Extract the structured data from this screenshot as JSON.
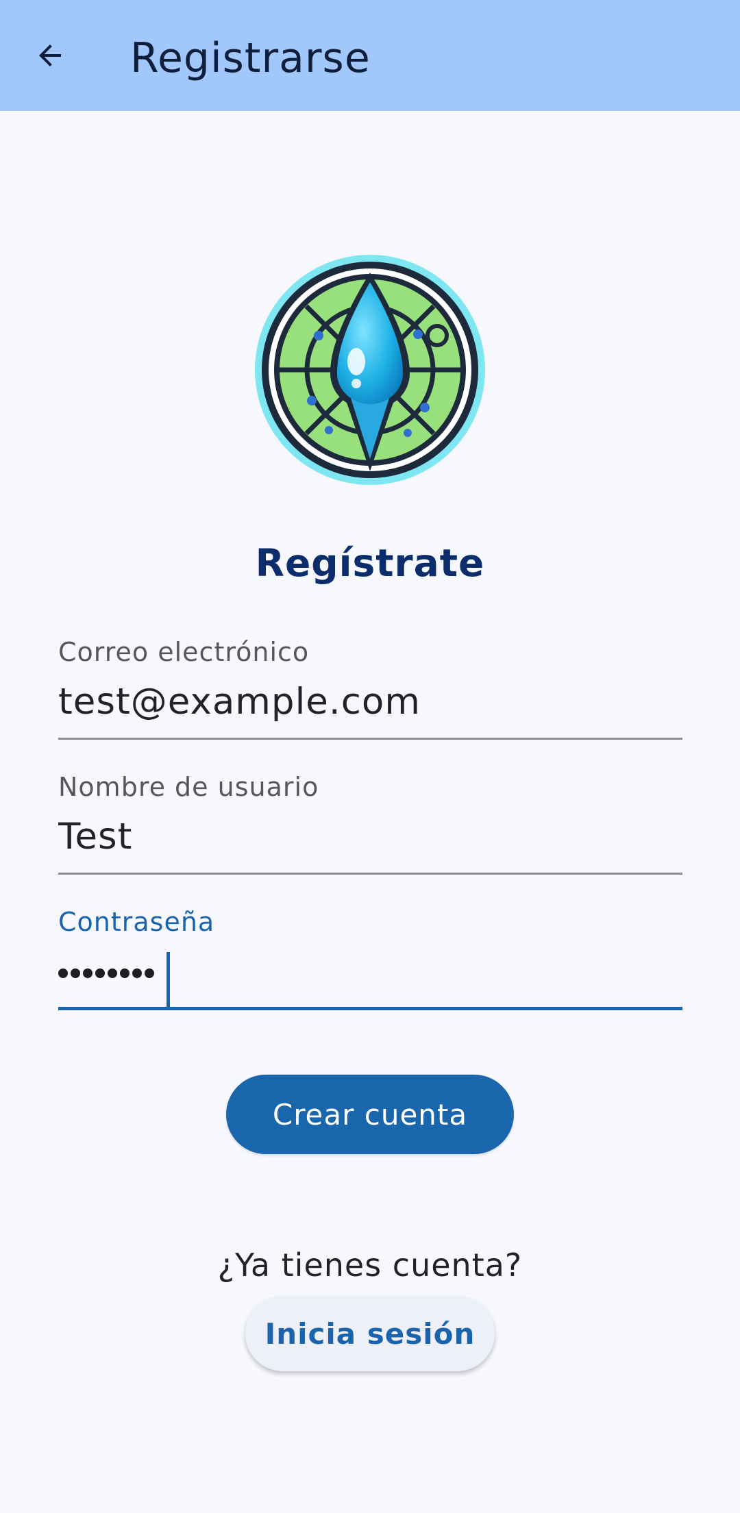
{
  "app_bar": {
    "title": "Registrarse",
    "back_icon": "arrow-back-icon"
  },
  "logo": {
    "icon": "water-drop-circuit-logo"
  },
  "heading": "Regístrate",
  "form": {
    "email": {
      "label": "Correo electrónico",
      "value": "test@example.com"
    },
    "username": {
      "label": "Nombre de usuario",
      "value": "Test"
    },
    "password": {
      "label": "Contraseña",
      "masked_length": 8
    }
  },
  "primary_button": {
    "label": "Crear cuenta"
  },
  "login_prompt": {
    "question": "¿Ya tienes cuenta?",
    "button_label": "Inicia sesión"
  },
  "colors": {
    "app_bar": "#a2c7fb",
    "background": "#f7f8fe",
    "primary": "#1a66ad",
    "heading": "#0c2d6b"
  }
}
